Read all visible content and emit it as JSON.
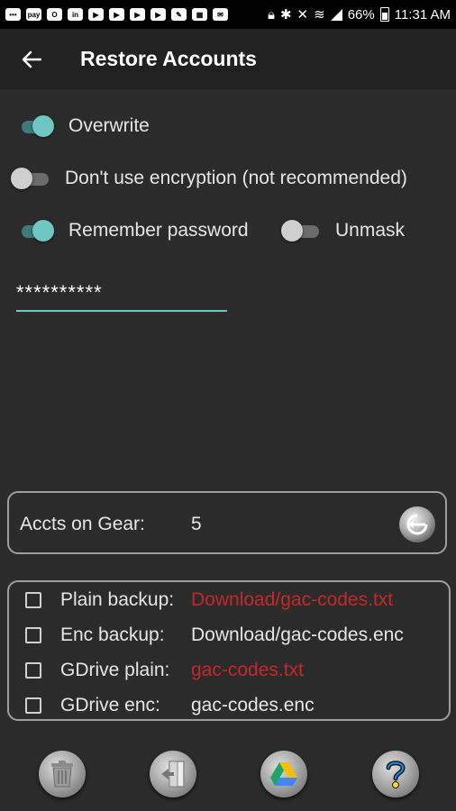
{
  "status_bar": {
    "time": "11:31 AM",
    "battery": "66%",
    "left_icons": [
      "chat-icon",
      "pay-icon",
      "outlook-icon",
      "linkedin-icon",
      "youtube-icon",
      "youtube-icon",
      "youtube-icon",
      "youtube-icon",
      "edit-icon",
      "photos-icon",
      "mail-icon"
    ],
    "pay_label": "pay",
    "linkedin_label": "in",
    "right_icons": [
      "lock-icon",
      "bluetooth-icon",
      "mute-icon",
      "wifi-icon",
      "signal-icon",
      "battery-icon"
    ]
  },
  "appbar": {
    "title": "Restore Accounts"
  },
  "options": {
    "overwrite": {
      "label": "Overwrite",
      "on": true
    },
    "no_encryption": {
      "label": "Don't use encryption (not recommended)",
      "on": false
    },
    "remember_password": {
      "label": "Remember password",
      "on": true
    },
    "unmask": {
      "label": "Unmask",
      "on": false
    }
  },
  "password": {
    "value": "**********"
  },
  "accounts": {
    "label": "Accts on Gear:",
    "count": "5"
  },
  "backups": [
    {
      "label": "Plain backup:",
      "path": "Download/gac-codes.txt",
      "checked": false,
      "path_color": "#c62828"
    },
    {
      "label": "Enc backup:",
      "path": "Download/gac-codes.enc",
      "checked": false,
      "path_color": "#e6e6e6"
    },
    {
      "label": "GDrive plain:",
      "path": "gac-codes.txt",
      "checked": false,
      "path_color": "#c62828"
    },
    {
      "label": "GDrive enc:",
      "path": "gac-codes.enc",
      "checked": false,
      "path_color": "#e6e6e6"
    }
  ],
  "bottom_buttons": [
    "trash-icon",
    "exit-door-icon",
    "google-drive-icon",
    "help-icon"
  ],
  "colors": {
    "accent": "#6ec6c0",
    "warning_path": "#c62828",
    "background": "#2b2b2b",
    "appbar": "#212121"
  }
}
